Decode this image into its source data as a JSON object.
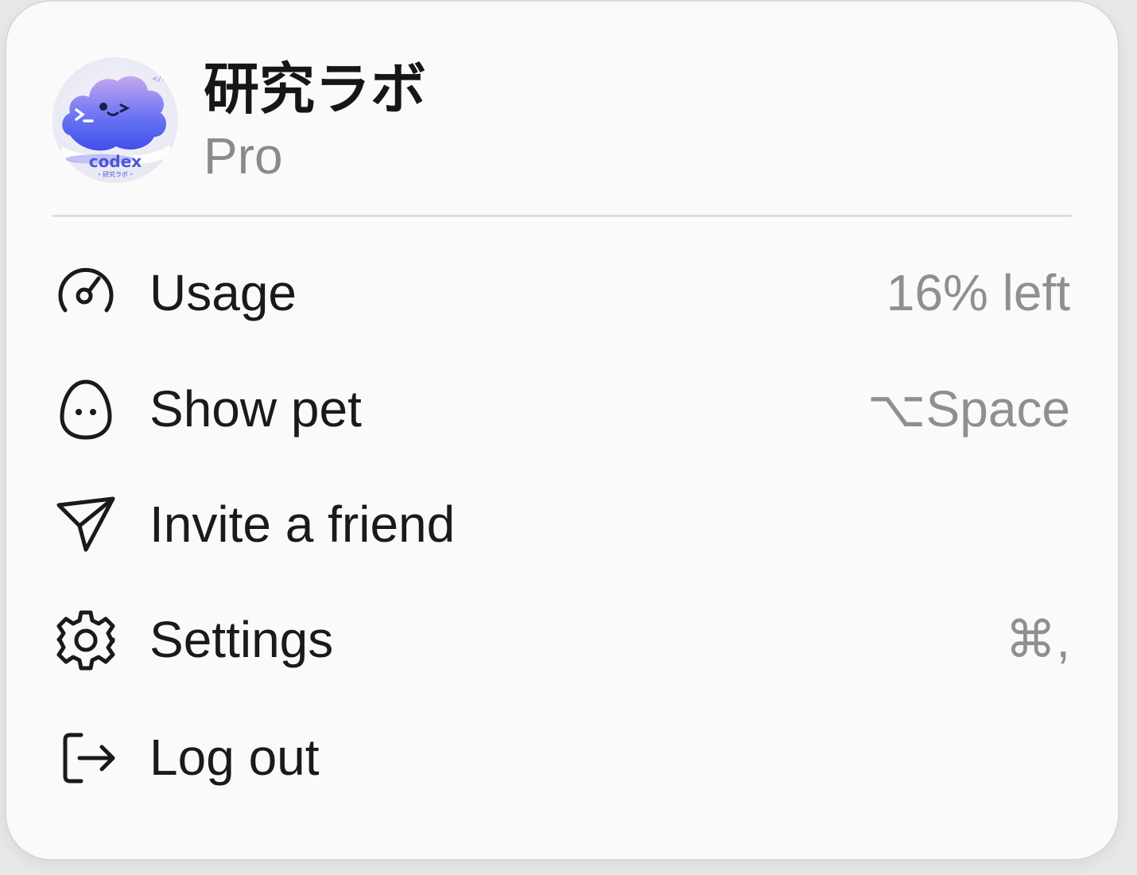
{
  "account": {
    "name": "研究ラボ",
    "plan": "Pro",
    "avatar_text": "codex",
    "avatar_subtext": "・研究ラボ・"
  },
  "menu": {
    "items": [
      {
        "icon": "gauge-icon",
        "label": "Usage",
        "trailing": "16% left"
      },
      {
        "icon": "pet-icon",
        "label": "Show pet",
        "trailing": "⌥Space"
      },
      {
        "icon": "send-icon",
        "label": "Invite a friend",
        "trailing": ""
      },
      {
        "icon": "gear-icon",
        "label": "Settings",
        "trailing": "⌘,"
      },
      {
        "icon": "logout-icon",
        "label": "Log out",
        "trailing": ""
      }
    ]
  },
  "colors": {
    "background": "#fafafa",
    "text": "#1a1a1a",
    "muted": "#8f8f8f",
    "divider": "#dedede",
    "avatar_accent": "#5b63f0"
  }
}
